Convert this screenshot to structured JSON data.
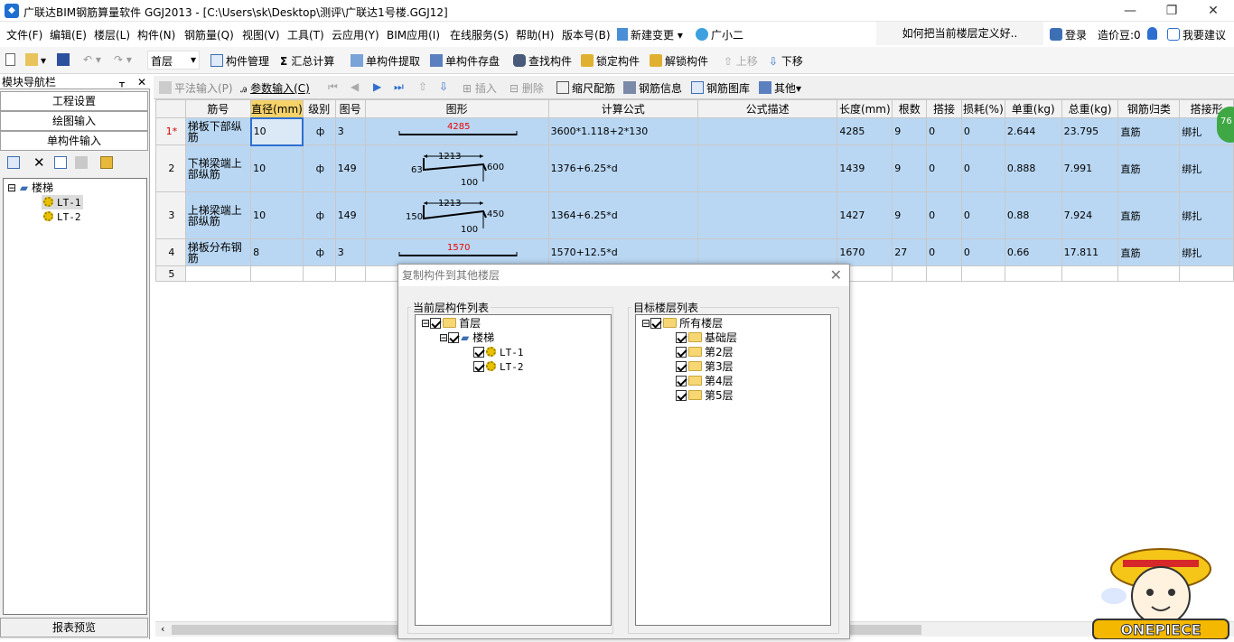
{
  "window": {
    "title": "广联达BIM钢筋算量软件 GGJ2013 - [C:\\Users\\sk\\Desktop\\测评\\广联达1号楼.GGJ12]",
    "min": "—",
    "restore": "❐",
    "close": "✕"
  },
  "menu": {
    "items": [
      "文件(F)",
      "编辑(E)",
      "楼层(L)",
      "构件(N)",
      "钢筋量(Q)",
      "视图(V)",
      "工具(T)",
      "云应用(Y)",
      "BIM应用(I)",
      "在线服务(S)",
      "帮助(H)",
      "版本号(B)",
      "新建变更",
      "广小二"
    ],
    "search_hint": "如何把当前楼层定义好..",
    "login": "登录",
    "price": "造价豆:0",
    "suggest": "我要建议"
  },
  "toolbar": {
    "floor": "首层",
    "component_manage": "构件管理",
    "sum_calc": "汇总计算",
    "single_extract": "单构件提取",
    "single_save": "单构件存盘",
    "find": "查找构件",
    "lock": "锁定构件",
    "unlock": "解锁构件",
    "up": "上移",
    "down": "下移"
  },
  "nav": {
    "header": "模块导航栏",
    "pin": "ᚁ",
    "close": "✕",
    "project_settings": "工程设置",
    "drawing_input": "绘图输入",
    "single_input": "单构件输入",
    "report_preview": "报表预览",
    "tree": {
      "root": "楼梯",
      "children": [
        "LT-1",
        "LT-2"
      ]
    }
  },
  "grid_toolbar": {
    "flat_input": "平法输入(P)",
    "param_input": "参数输入(C)",
    "insert": "插入",
    "delete": "删除",
    "scale": "缩尺配筋",
    "rebar_info": "钢筋信息",
    "rebar_lib": "钢筋图库",
    "other": "其他"
  },
  "grid": {
    "headers": [
      "筋号",
      "直径(mm)",
      "级别",
      "图号",
      "图形",
      "计算公式",
      "公式描述",
      "长度(mm)",
      "根数",
      "搭接",
      "损耗(%)",
      "单重(kg)",
      "总重(kg)",
      "钢筋归类",
      "搭接形"
    ],
    "rows": [
      {
        "num": "1*",
        "name": "梯板下部纵筋",
        "dia": "10",
        "grade": "ф",
        "fig": "3",
        "shape_a": "4285",
        "formula": "3600*1.118+2*130",
        "desc": "",
        "len": "4285",
        "count": "9",
        "lap": "0",
        "loss": "0",
        "unit": "2.644",
        "total": "23.795",
        "cat": "直筋",
        "lapform": "绑扎"
      },
      {
        "num": "2",
        "name": "下梯梁端上部纵筋",
        "dia": "10",
        "grade": "ф",
        "fig": "149",
        "shape_a": "1213",
        "shape_b": "63",
        "shape_c": "600",
        "shape_d": "100",
        "formula": "1376+6.25*d",
        "desc": "",
        "len": "1439",
        "count": "9",
        "lap": "0",
        "loss": "0",
        "unit": "0.888",
        "total": "7.991",
        "cat": "直筋",
        "lapform": "绑扎"
      },
      {
        "num": "3",
        "name": "上梯梁端上部纵筋",
        "dia": "10",
        "grade": "ф",
        "fig": "149",
        "shape_a": "1213",
        "shape_b": "150",
        "shape_c": "450",
        "shape_d": "100",
        "formula": "1364+6.25*d",
        "desc": "",
        "len": "1427",
        "count": "9",
        "lap": "0",
        "loss": "0",
        "unit": "0.88",
        "total": "7.924",
        "cat": "直筋",
        "lapform": "绑扎"
      },
      {
        "num": "4",
        "name": "梯板分布钢筋",
        "dia": "8",
        "grade": "ф",
        "fig": "3",
        "shape_a": "1570",
        "formula": "1570+12.5*d",
        "desc": "",
        "len": "1670",
        "count": "27",
        "lap": "0",
        "loss": "0",
        "unit": "0.66",
        "total": "17.811",
        "cat": "直筋",
        "lapform": "绑扎"
      },
      {
        "num": "5"
      }
    ]
  },
  "dialog": {
    "title": "复制构件到其他楼层",
    "close": "✕",
    "left_label": "当前层构件列表",
    "right_label": "目标楼层列表",
    "left_tree": {
      "root": "首层",
      "child": "楼梯",
      "leaves": [
        "LT-1",
        "LT-2"
      ]
    },
    "right_tree": {
      "root": "所有楼层",
      "floors": [
        "基础层",
        "第2层",
        "第3层",
        "第4层",
        "第5层"
      ]
    }
  },
  "badge": "76",
  "mascot_text": "ONEPIECE"
}
